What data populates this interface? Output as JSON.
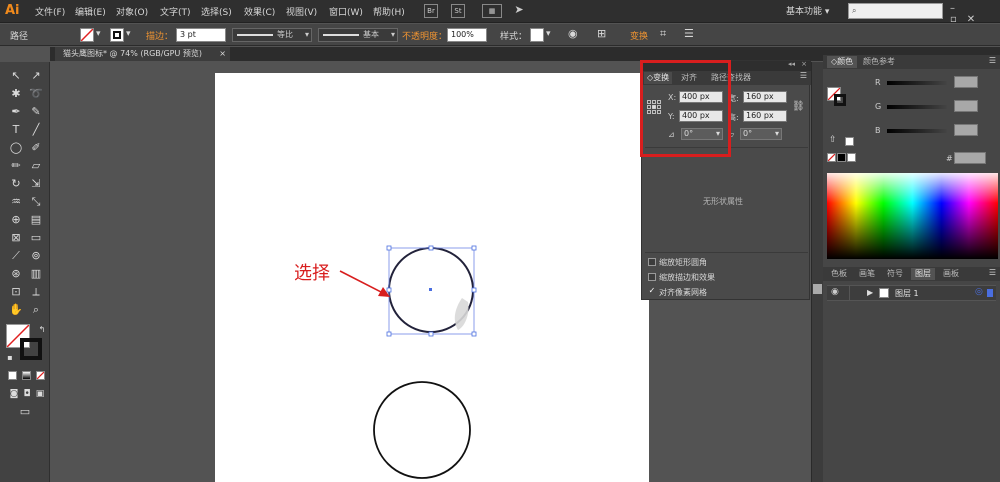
{
  "app": {
    "logo": "Ai"
  },
  "menu": [
    "文件(F)",
    "编辑(E)",
    "对象(O)",
    "文字(T)",
    "选择(S)",
    "效果(C)",
    "视图(V)",
    "窗口(W)",
    "帮助(H)"
  ],
  "menubar_extra": {
    "bridge": "Br",
    "stock": "St",
    "workspace": "基本功能",
    "workspace_arrow": "▾",
    "search_placeholder": "",
    "window_controls": "–▫✕"
  },
  "control_bar": {
    "object_label": "路径",
    "stroke_label": "描边：",
    "stroke_value": "3 pt",
    "profile_label": "等比",
    "brush_label": "基本",
    "opacity_label": "不透明度：",
    "opacity_value": "100%",
    "style_label": "样式：",
    "transform_link": "变换"
  },
  "document_tab": {
    "title": "猫头鹰图标* @ 74% (RGB/GPU 预览)",
    "close": "×"
  },
  "transform_panel": {
    "tabs": [
      "变换",
      "对齐",
      "路径查找器"
    ],
    "x_label": "X:",
    "x_value": "400 px",
    "y_label": "Y:",
    "y_value": "400 px",
    "w_label": "宽:",
    "w_value": "160 px",
    "h_label": "高:",
    "h_value": "160 px",
    "rotate_value": "0°",
    "shear_value": "0°",
    "no_shape_text": "无形状属性",
    "checkboxes": [
      {
        "label": "缩放矩形圆角",
        "checked": false
      },
      {
        "label": "缩放描边和效果",
        "checked": false
      },
      {
        "label": "对齐像素网格",
        "checked": true
      }
    ]
  },
  "color_panel": {
    "tabs": [
      "颜色",
      "颜色参考"
    ],
    "channels": [
      "R",
      "G",
      "B"
    ],
    "hex_label": "#"
  },
  "layers_panel": {
    "tabs": [
      "色板",
      "画笔",
      "符号",
      "图层",
      "画板"
    ],
    "layer_name": "图层 1"
  },
  "annotation": {
    "label": "选择"
  },
  "colors": {
    "accent_orange": "#f09431",
    "highlight_red": "#d81e1e",
    "selection_blue": "#4a6ee0"
  }
}
